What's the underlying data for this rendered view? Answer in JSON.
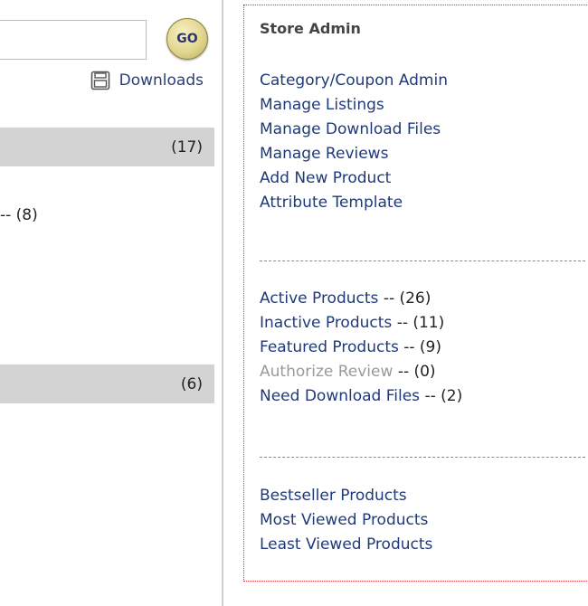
{
  "search": {
    "value": "",
    "placeholder": ""
  },
  "go_button": {
    "label": "GO"
  },
  "downloads": {
    "label": "Downloads",
    "icon": "disk-icon"
  },
  "counts": {
    "bar1": "(17)",
    "item": "-- (8)",
    "bar2": "(6)"
  },
  "store_admin": {
    "title": "Store Admin",
    "admin_links": [
      "Category/Coupon Admin",
      "Manage Listings",
      "Manage Download Files",
      "Manage Reviews",
      "Add New Product",
      "Attribute Template"
    ],
    "product_links": [
      {
        "label": "Active Products",
        "count": "-- (26)"
      },
      {
        "label": "Inactive Products",
        "count": "-- (11)"
      },
      {
        "label": "Featured Products",
        "count": "-- (9)"
      },
      {
        "label": "Authorize Review",
        "count": "-- (0)"
      },
      {
        "label": "Need Download Files",
        "count": "-- (2)"
      }
    ],
    "report_links": [
      "Bestseller Products",
      "Most Viewed Products",
      "Least Viewed Products"
    ]
  },
  "colors": {
    "link": "#1f3a7a",
    "disabled_link": "#9a9a9a",
    "bar": "#d3d3d3",
    "box_border": "#d23a3a"
  }
}
